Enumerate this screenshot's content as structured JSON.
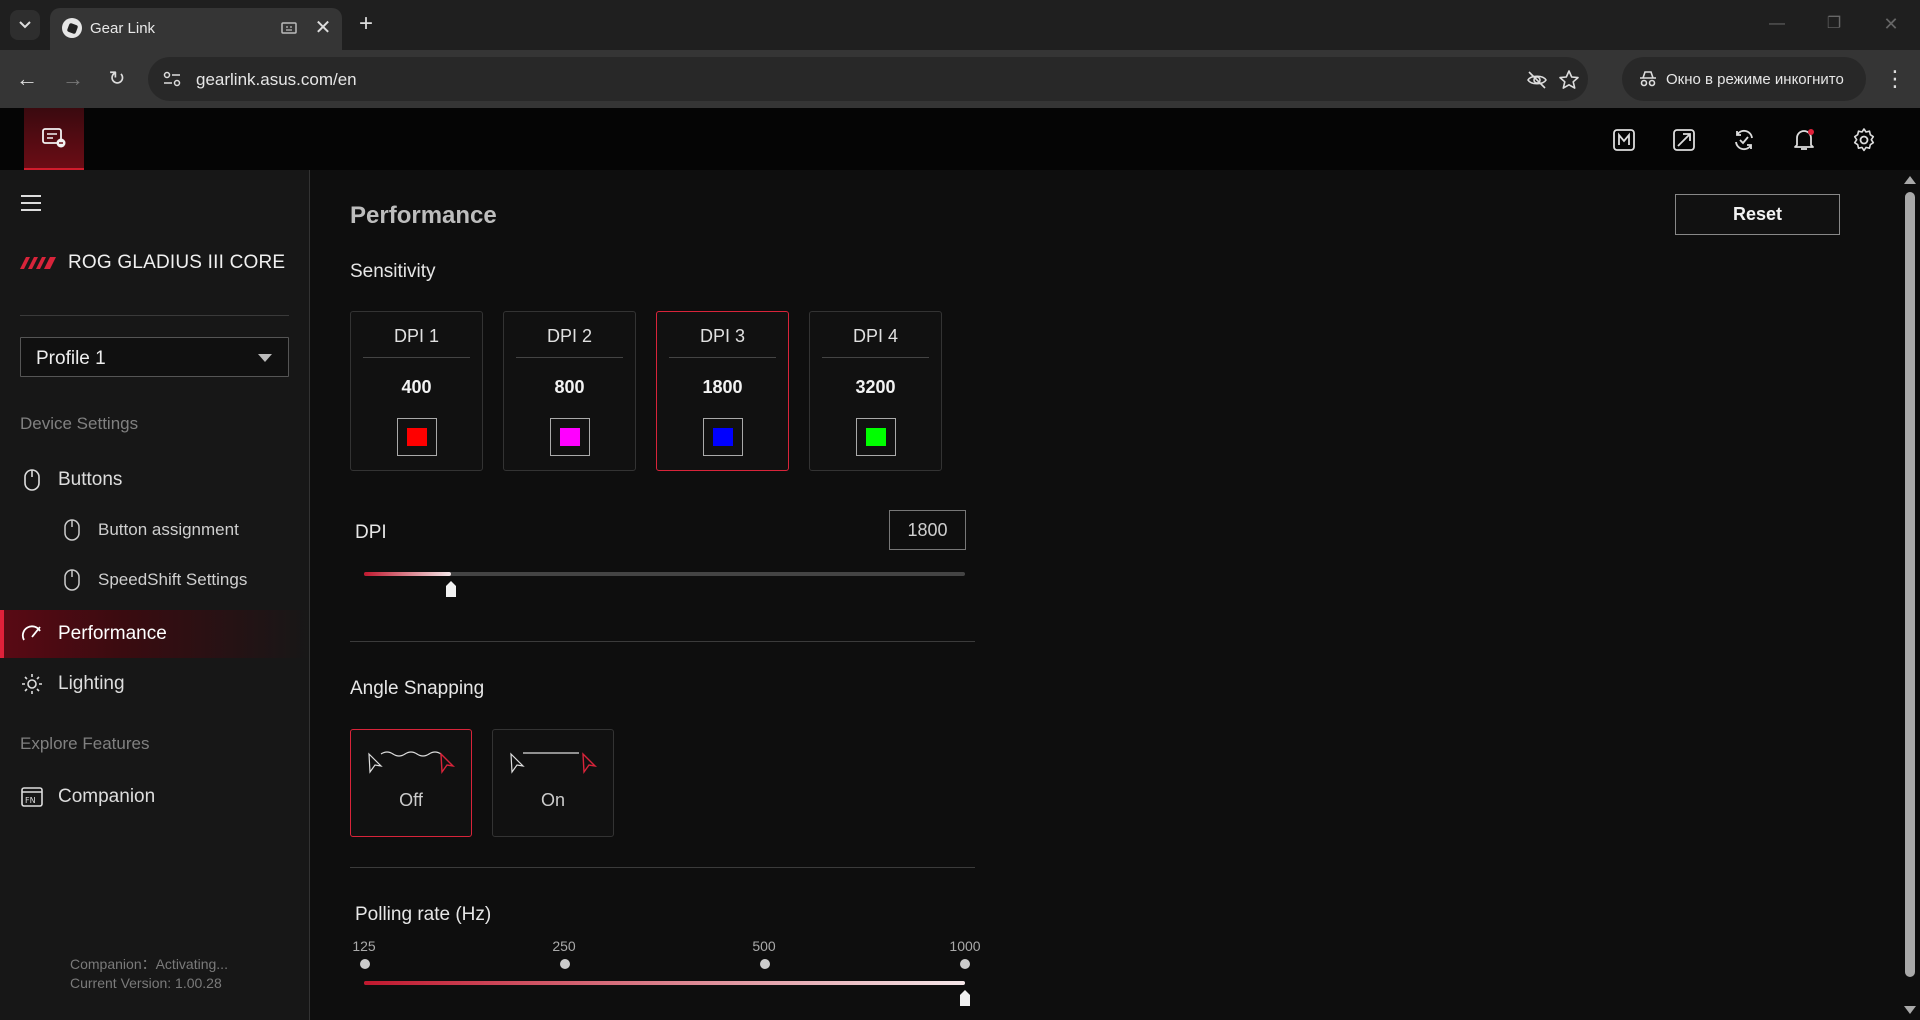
{
  "browser": {
    "tab_title": "Gear Link",
    "url": "gearlink.asus.com/en",
    "incognito_label": "Окно в режиме инкогнито"
  },
  "sidebar": {
    "device_name": "ROG GLADIUS III CORE",
    "profile": "Profile 1",
    "group_device": "Device Settings",
    "items": [
      {
        "label": "Buttons"
      },
      {
        "label": "Button assignment"
      },
      {
        "label": "SpeedShift Settings"
      },
      {
        "label": "Performance"
      },
      {
        "label": "Lighting"
      }
    ],
    "group_explore": "Explore Features",
    "companion": "Companion",
    "companion_status": "Companion：Activating...",
    "version": "Current Version: 1.00.28"
  },
  "main": {
    "title": "Performance",
    "reset_label": "Reset",
    "sensitivity_label": "Sensitivity",
    "dpi_cards": [
      {
        "name": "DPI 1",
        "value": "400",
        "color": "#ff0000"
      },
      {
        "name": "DPI 2",
        "value": "800",
        "color": "#ff00ff"
      },
      {
        "name": "DPI 3",
        "value": "1800",
        "color": "#0000ff"
      },
      {
        "name": "DPI 4",
        "value": "3200",
        "color": "#00ff00"
      }
    ],
    "selected_dpi_index": 2,
    "dpi_label": "DPI",
    "dpi_value": "1800",
    "dpi_slider_fraction": 0.145,
    "angle_snapping_label": "Angle Snapping",
    "angle_snapping": [
      {
        "label": "Off",
        "selected": true
      },
      {
        "label": "On",
        "selected": false
      }
    ],
    "polling_label": "Polling rate (Hz)",
    "polling_ticks": [
      "125",
      "250",
      "500",
      "1000"
    ],
    "polling_selected": "1000"
  },
  "colors": {
    "accent": "#d8243a",
    "background": "#0e0e0e",
    "sidebar": "#171717"
  }
}
